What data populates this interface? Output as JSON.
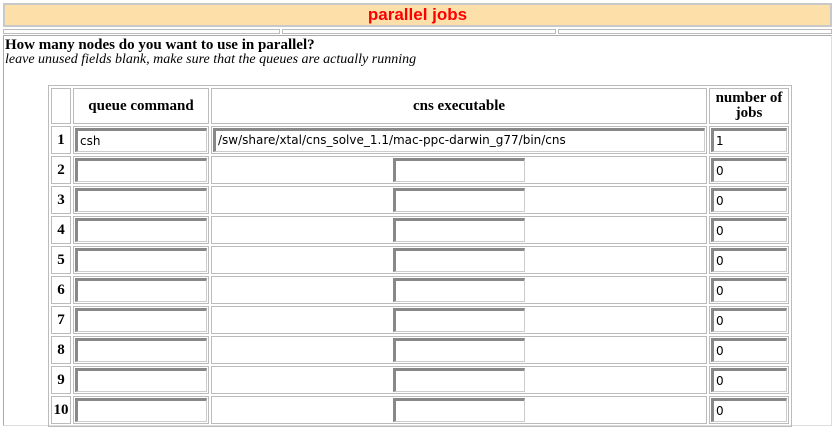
{
  "title": "parallel jobs",
  "question": "How many nodes do you want to use in parallel?",
  "hint": "leave unused fields blank, make sure that the queues are actually running",
  "headers": {
    "queue": "queue command",
    "cns": "cns executable",
    "jobs": "number of jobs"
  },
  "rows": [
    {
      "n": "1",
      "queue": "csh",
      "cns": "/sw/share/xtal/cns_solve_1.1/mac-ppc-darwin_g77/bin/cns",
      "jobs": "1"
    },
    {
      "n": "2",
      "queue": "",
      "cns": "",
      "jobs": "0"
    },
    {
      "n": "3",
      "queue": "",
      "cns": "",
      "jobs": "0"
    },
    {
      "n": "4",
      "queue": "",
      "cns": "",
      "jobs": "0"
    },
    {
      "n": "5",
      "queue": "",
      "cns": "",
      "jobs": "0"
    },
    {
      "n": "6",
      "queue": "",
      "cns": "",
      "jobs": "0"
    },
    {
      "n": "7",
      "queue": "",
      "cns": "",
      "jobs": "0"
    },
    {
      "n": "8",
      "queue": "",
      "cns": "",
      "jobs": "0"
    },
    {
      "n": "9",
      "queue": "",
      "cns": "",
      "jobs": "0"
    },
    {
      "n": "10",
      "queue": "",
      "cns": "",
      "jobs": "0"
    }
  ]
}
